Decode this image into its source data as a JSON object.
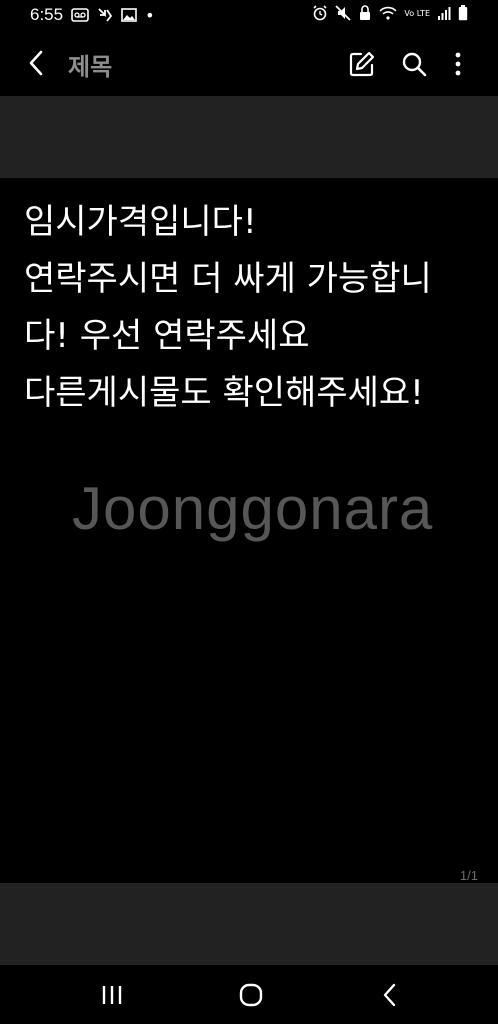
{
  "status_bar": {
    "time": "6:55",
    "dot": "•",
    "left_icons": [
      "voicemail-icon",
      "missed-call-icon",
      "image-icon"
    ],
    "right_icons": [
      "alarm-icon",
      "mute-icon",
      "lock-icon",
      "wifi-icon",
      "signal-icon",
      "battery-icon"
    ],
    "network": "Vo LTE"
  },
  "app_bar": {
    "title": "제목",
    "icons": [
      "back-arrow-icon",
      "edit-icon",
      "search-icon",
      "more-vert-icon"
    ]
  },
  "note": {
    "text": "임시가격입니다!\n연락주시면 더 싸게 가능합니다! 우선 연락주세요\n다른게시물도 확인해주세요!",
    "watermark": "Joonggonara",
    "page_indicator": "1/1"
  },
  "colors": {
    "background": "#000000",
    "band": "#222222",
    "title": "#8e8e8e",
    "watermark": "#575757"
  },
  "nav_bar": {
    "icons": [
      "recent-apps-icon",
      "home-icon",
      "nav-back-icon"
    ]
  }
}
